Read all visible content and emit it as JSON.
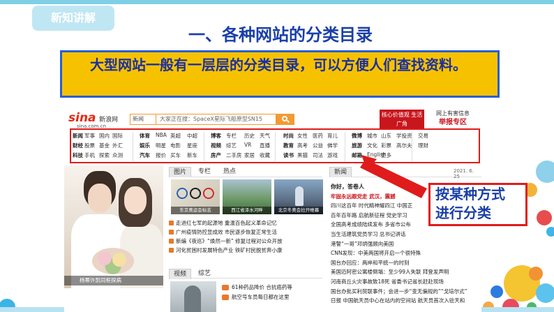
{
  "slide": {
    "tag": "新知讲解",
    "title": "一、各种网站的分类目录",
    "statement": "大型网站一般有一层层的分类目录，可以方便人们查找资料。",
    "callout_line1": "按某种方式",
    "callout_line2": "进行分类"
  },
  "sina": {
    "logo_text": "sina",
    "logo_cn": "新浪网",
    "logo_url": "sina.com.cn",
    "search_type": "新闻",
    "search_query": "大家正在搜：SpaceX星际飞船原型SN15",
    "banner_text": "核心价值观 生活广角",
    "report_line1": "网上有害信息",
    "report_line2": "举报专区",
    "nav": [
      [
        "新闻",
        "军事",
        "国内",
        "国际",
        "体育",
        "NBA",
        "英超",
        "中超",
        "博客",
        "专栏",
        "历史",
        "天气",
        "时尚",
        "女性",
        "医药",
        "育儿",
        "微博",
        "城市",
        "山东",
        "学投资",
        "交易"
      ],
      [
        "财经",
        "股票",
        "基金",
        "外汇",
        "娱乐",
        "明星",
        "电影",
        "星座",
        "视频",
        "综艺",
        "VR",
        "直播",
        "教育",
        "高考",
        "公益",
        "佛学",
        "旅游",
        "文化",
        "彩票",
        "高尔夫",
        "理财"
      ],
      [
        "科技",
        "手机",
        "探索",
        "众测",
        "汽车",
        "报价",
        "买车",
        "新车",
        "房产",
        "二手房",
        "家居",
        "收藏",
        "读书",
        "黑猫",
        "司法",
        "游戏",
        "邮箱",
        "English",
        "更多"
      ]
    ],
    "tab_photos": "图片",
    "tab_columns": "专栏",
    "tab_hot": "热点",
    "tab_news": "新闻",
    "date": "2021. 6. 25",
    "photo_caption": "杨幂许凯同框探病",
    "thumb1_caption": "东京奥运会标志",
    "thumb2_caption": "西江省泽水河畔",
    "thumb3_caption": "北京冬奥会拉开帷幕",
    "left_news": [
      "走进红七军的起源地 重温百色起义革命记忆",
      "广州疫情防控显成效 市民逐步恢复正常生活",
      "新编《夜巡》“焕然一新” 修复过程对公众开放",
      "河化贫困村发展特色产业 铁矿村民脱贫奔小康"
    ],
    "tab_video": "视频",
    "tab_variety": "综艺",
    "video_news": [
      "61种药品降价 合抗癌药等",
      "航空号车员每日都在这里"
    ],
    "right_news": [
      "你好，答卷人",
      "牢固永远跟党走 武汉，震撼",
      "四川这百年 时代精神耀四江 中国正",
      "百年百年路 启航新征程 党史学习",
      "全国高考成绩陆续发布 多省市公布",
      "当生活建筑党员学习 总书记讲话",
      "港警“一哥”邓炳强顾向美国",
      "CNN发现：中美两国将开启一个很特殊",
      "国台办回应：两岸和平统一的时刻",
      "美国迈阿密公寓楼倒塌：至少99人失联 拜登发声明",
      "河南商丘火灾事故致18死 省委书记省长赶赴现场",
      "国台办批买利贸联事件；会进一步“变无偏规的”“戈培尔式”",
      "日报 中国航天员中心在站内的空间站 航天员首次入驻天和"
    ]
  },
  "colors": {
    "title_blue": "#1a3fa8",
    "highlight_yellow": "#f6c200",
    "outline_red": "#e01b1b",
    "sina_orange": "#f39a32"
  }
}
